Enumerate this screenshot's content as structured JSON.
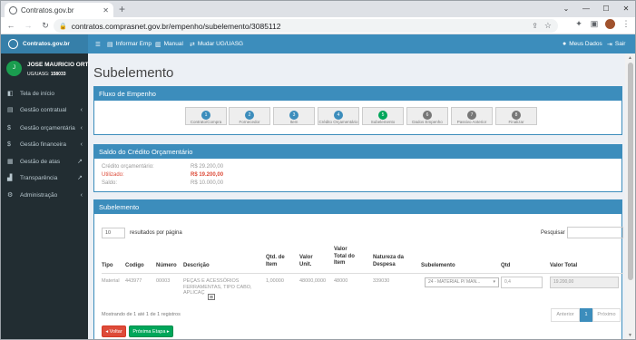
{
  "browser": {
    "tab_title": "Contratos.gov.br",
    "url": "contratos.comprasnet.gov.br/empenho/subelemento/3085112"
  },
  "topnav": {
    "logo": "Contratos.gov.br",
    "informar_empenho": "Informar Emp",
    "manual": "Manual",
    "mudar": "Mudar UG/UASG",
    "meus_dados": "Meus Dados",
    "sair": "Sair"
  },
  "user": {
    "name": "JOSE MAURICIO ORTIZ...",
    "ug_prefix": "UG/UASG: ",
    "ug_code": "158033"
  },
  "sidebar": {
    "items": [
      {
        "label": "Tela de início",
        "icon": "dashboard-icon",
        "arrow": ""
      },
      {
        "label": "Gestão contratual",
        "icon": "file-icon",
        "arrow": "‹"
      },
      {
        "label": "Gestão orçamentária",
        "icon": "dollar-icon",
        "arrow": "‹"
      },
      {
        "label": "Gestão financeira",
        "icon": "dollar-icon",
        "arrow": "‹"
      },
      {
        "label": "Gestão de atas",
        "icon": "clipboard-icon",
        "arrow": "↗"
      },
      {
        "label": "Transparência",
        "icon": "chart-icon",
        "arrow": "↗"
      },
      {
        "label": "Administração",
        "icon": "cogs-icon",
        "arrow": "‹"
      }
    ]
  },
  "page": {
    "title": "Subelemento"
  },
  "fluxo": {
    "title": "Fluxo de Empenho",
    "steps": [
      {
        "num": "1",
        "label": "Contrato/Compra",
        "state": "done"
      },
      {
        "num": "2",
        "label": "Fornecedor",
        "state": "done"
      },
      {
        "num": "3",
        "label": "Item",
        "state": "done"
      },
      {
        "num": "4",
        "label": "Crédito Orçamentário",
        "state": "done"
      },
      {
        "num": "5",
        "label": "Subelemento",
        "state": "active"
      },
      {
        "num": "6",
        "label": "Dados Empenho",
        "state": "off"
      },
      {
        "num": "7",
        "label": "Passivo Anterior",
        "state": "off"
      },
      {
        "num": "8",
        "label": "Finalizar",
        "state": "off"
      }
    ]
  },
  "saldo": {
    "title": "Saldo do Crédito Orçamentário",
    "rows": [
      {
        "label": "Crédito orçamentário:",
        "value": "R$ 29.200,00",
        "highlight": false
      },
      {
        "label": "Utilizado:",
        "value": "R$ 19.200,00",
        "highlight": true
      },
      {
        "label": "Saldo:",
        "value": "R$ 10.000,00",
        "highlight": false
      }
    ]
  },
  "sub": {
    "title": "Subelemento",
    "entries_value": "10",
    "entries_label": "resultados por página",
    "search_label": "Pesquisar",
    "headers": {
      "tipo": "Tipo",
      "codigo": "Codigo",
      "numero": "Número",
      "descricao": "Descrição",
      "qtd_item": "Qtd. de Item",
      "valor_unit": "Valor Unit.",
      "valor_total_item": "Valor Total do Item",
      "natureza": "Natureza da Despesa",
      "subelemento": "Subelemento",
      "qtd": "Qtd",
      "valor_total": "Valor Total"
    },
    "row": {
      "tipo": "Material",
      "codigo": "443977",
      "numero": "00003",
      "descricao": "PEÇAS E ACESSÓRIOS FERRAMENTAS, TIPO CABO, APLICAÇ",
      "expand": "⊞",
      "qtd_item": "1,00000",
      "valor_unit": "48000,0000",
      "valor_total_item": "48000",
      "natureza": "339030",
      "subelemento": "24 - MATERIAL P/ MAN...",
      "qtd": "0,4",
      "valor_total": "19.200,00"
    },
    "info": "Mostrando de 1 até 1 de 1 registros",
    "prev": "Anterior",
    "page": "1",
    "next": "Próximo",
    "voltar": "Voltar",
    "proxima": "Próxima Etapa"
  }
}
